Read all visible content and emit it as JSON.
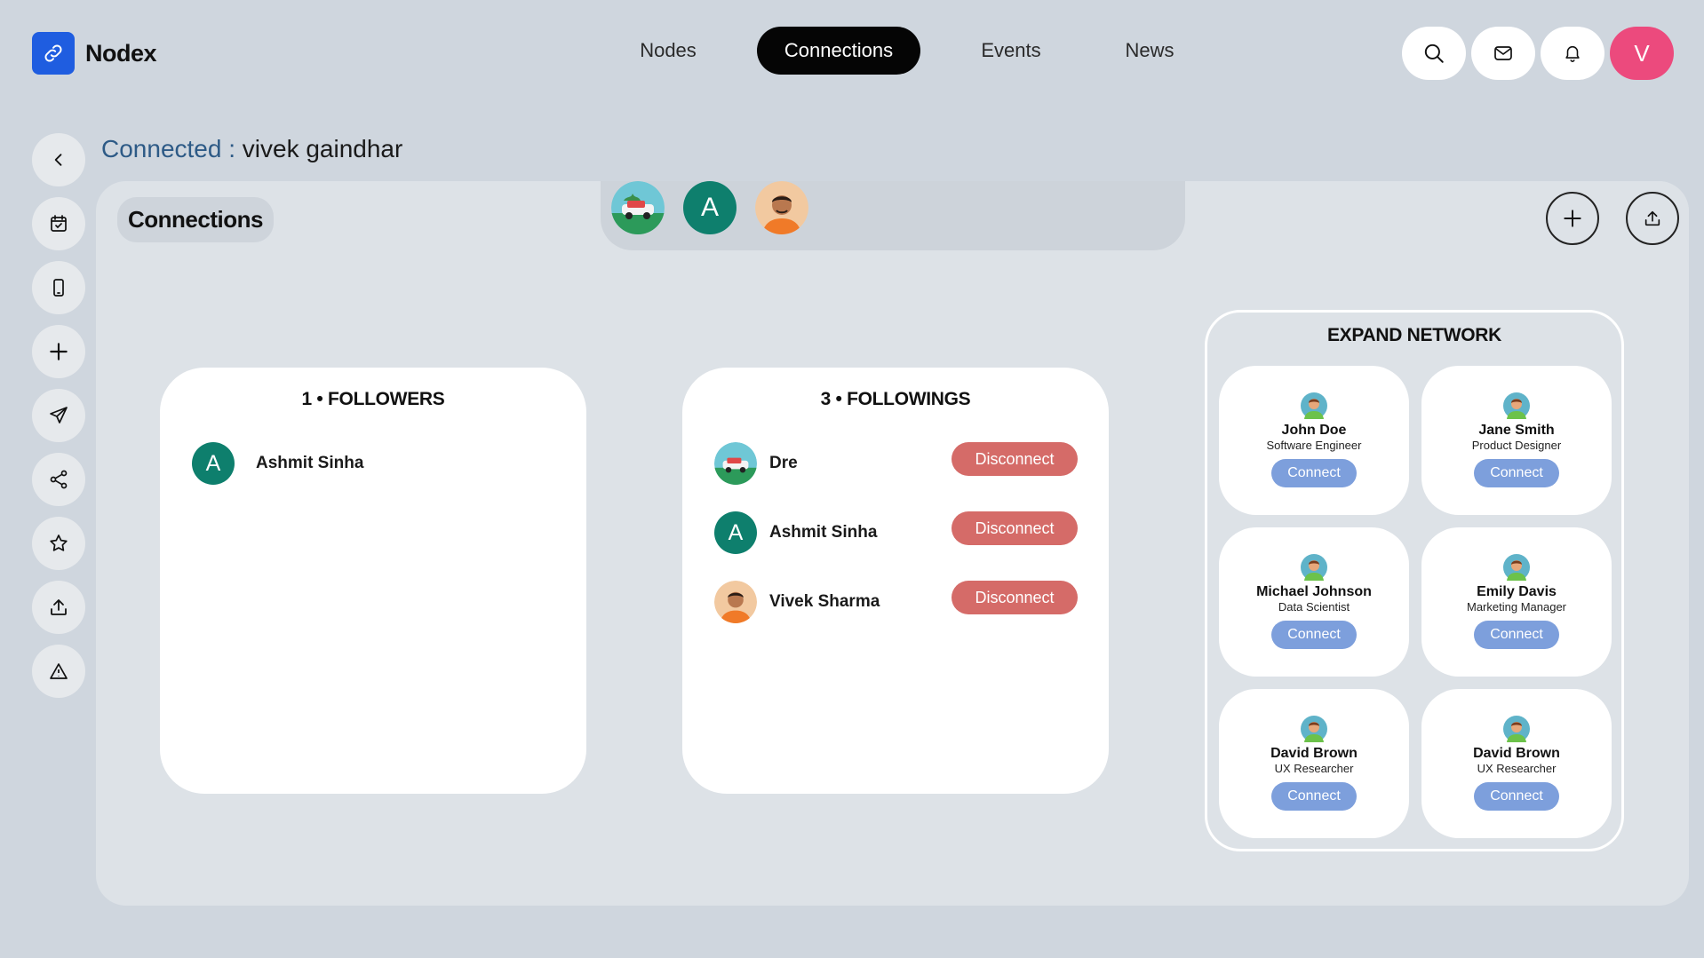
{
  "app": {
    "name": "Nodex",
    "logo_icon": "link-icon",
    "brand_color": "#1f5de0"
  },
  "nav": {
    "items": [
      {
        "label": "Nodes",
        "active": false
      },
      {
        "label": "Connections",
        "active": true
      },
      {
        "label": "Events",
        "active": false
      },
      {
        "label": "News",
        "active": false
      }
    ]
  },
  "header_actions": {
    "icons": [
      "search-icon",
      "mail-icon",
      "bell-icon"
    ],
    "user_initial": "V",
    "user_color": "#ec4a7d"
  },
  "sidebar": {
    "icons": [
      "back-icon",
      "calendar-check-icon",
      "phone-icon",
      "plus-icon",
      "send-icon",
      "share-icon",
      "star-icon",
      "upload-icon",
      "warning-icon"
    ]
  },
  "page": {
    "title_label": "Connected :",
    "title_user": "vivek gaindhar"
  },
  "panel": {
    "title": "Connections",
    "tab_avatars": [
      {
        "type": "image",
        "alt": "car-avatar"
      },
      {
        "type": "letter",
        "letter": "A"
      },
      {
        "type": "image",
        "alt": "person-avatar"
      }
    ]
  },
  "followers": {
    "title": "1 • FOLLOWERS",
    "items": [
      {
        "name": "Ashmit Sinha",
        "letter": "A"
      }
    ]
  },
  "followings": {
    "title": "3 • FOLLOWINGS",
    "action_label": "Disconnect",
    "items": [
      {
        "name": "Dre",
        "avatar": "car"
      },
      {
        "name": "Ashmit Sinha",
        "avatar": "letter",
        "letter": "A"
      },
      {
        "name": "Vivek Sharma",
        "avatar": "person"
      }
    ]
  },
  "expand_network": {
    "title": "EXPAND NETWORK",
    "action_label": "Connect",
    "suggestions": [
      {
        "name": "John Doe",
        "role": "Software Engineer"
      },
      {
        "name": "Jane Smith",
        "role": "Product Designer"
      },
      {
        "name": "Michael Johnson",
        "role": "Data Scientist"
      },
      {
        "name": "Emily Davis",
        "role": "Marketing Manager"
      },
      {
        "name": "David Brown",
        "role": "UX Researcher"
      },
      {
        "name": "David Brown",
        "role": "UX Researcher"
      }
    ]
  },
  "colors": {
    "disconnect": "#d56b68",
    "connect": "#7d9fdc",
    "letter_avatar": "#0e7f6d"
  }
}
